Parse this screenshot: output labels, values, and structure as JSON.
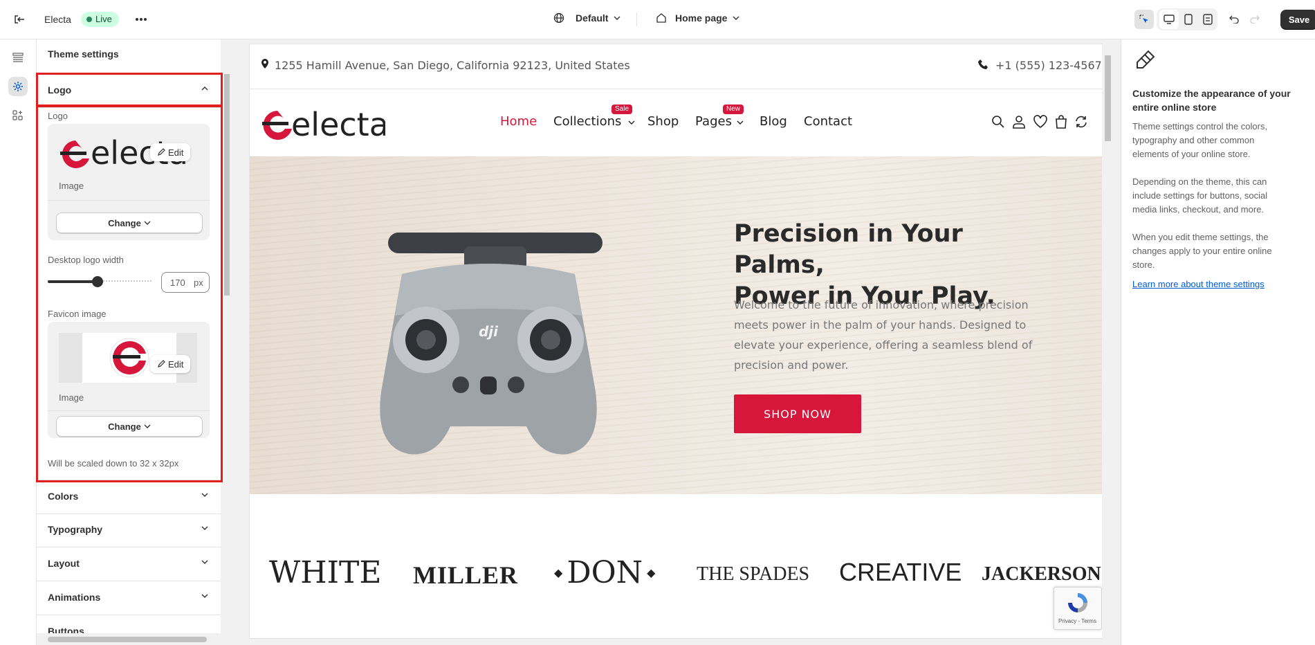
{
  "topbar": {
    "store_name": "Electa",
    "status_badge": "Live",
    "theme_selector": "Default",
    "page_selector": "Home page",
    "save_label": "Save"
  },
  "sidebar": {
    "title": "Theme settings",
    "sections": {
      "logo": {
        "title": "Logo",
        "logo_label": "Logo",
        "logo_image_label": "Image",
        "logo_image_text": "electa",
        "edit_label": "Edit",
        "change_label": "Change",
        "width_label": "Desktop logo width",
        "width_value": "170",
        "width_unit": "px",
        "width_fraction": 0.48,
        "favicon_label": "Favicon image",
        "favicon_image_label": "Image",
        "favicon_edit_label": "Edit",
        "favicon_change_label": "Change",
        "favicon_hint": "Will be scaled down to 32 x 32px"
      }
    },
    "collapsed": [
      "Colors",
      "Typography",
      "Layout",
      "Animations",
      "Buttons"
    ]
  },
  "preview": {
    "address": "1255 Hamill Avenue, San Diego, California 92123, United States",
    "phone": "+1 (555) 123-4567",
    "logo_text": "electa",
    "nav": [
      {
        "label": "Home",
        "active": true
      },
      {
        "label": "Collections",
        "badge": "Sale",
        "dropdown": true
      },
      {
        "label": "Shop"
      },
      {
        "label": "Pages",
        "badge": "New",
        "dropdown": true
      },
      {
        "label": "Blog"
      },
      {
        "label": "Contact"
      }
    ],
    "hero": {
      "heading_line1": "Precision in Your Palms,",
      "heading_line2": "Power in Your Play.",
      "body": "Welcome to the future of innovation, where precision meets power in the palm of your hands. Designed to elevate your experience, offering a seamless blend of precision and power.",
      "cta": "SHOP NOW",
      "controller_brand": "dji"
    },
    "brands": [
      "WHITE",
      "MILLER",
      "DON",
      "THE SPADES",
      "CREATIVE",
      "JACKERSON"
    ],
    "recaptcha": "Privacy - Terms"
  },
  "rightpanel": {
    "title": "Customize the appearance of your entire online store",
    "p1": "Theme settings control the colors, typography and other common elements of your online store.",
    "p2": "Depending on the theme, this can include settings for buttons, social media links, checkout, and more.",
    "p3": "When you edit theme settings, the changes apply to your entire online store.",
    "link": "Learn more about theme settings"
  },
  "colors": {
    "accent": "#d6163a",
    "highlight": "#e11f1f",
    "link": "#005bd3"
  }
}
